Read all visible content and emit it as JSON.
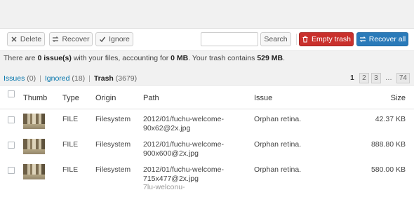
{
  "toolbar": {
    "delete_label": "Delete",
    "recover_label": "Recover",
    "ignore_label": "Ignore",
    "search_placeholder": "",
    "search_label": "Search",
    "empty_trash_label": "Empty trash",
    "recover_all_label": "Recover all"
  },
  "summary": {
    "before": "There are ",
    "issues": "0 issue(s)",
    "middle1": " with your files, accounting for ",
    "size": "0 MB",
    "middle2": ". Your trash contains ",
    "trash": "529 MB",
    "end": "."
  },
  "filters": [
    {
      "label": "Issues",
      "count": "(0)"
    },
    {
      "label": "Ignored",
      "count": "(18)"
    },
    {
      "label": "Trash",
      "count": "(3679)"
    }
  ],
  "pagination": [
    "1",
    "2",
    "3",
    "…",
    "74"
  ],
  "table": {
    "headers": [
      "Thumb",
      "Type",
      "Origin",
      "Path",
      "Issue",
      "Size"
    ],
    "rows": [
      {
        "type": "FILE",
        "origin": "Filesystem",
        "path1": "2012/01/fuchu-welcome-",
        "path2": "90x62@2x.jpg",
        "issue": "Orphan retina.",
        "size": "42.37 KB"
      },
      {
        "type": "FILE",
        "origin": "Filesystem",
        "path1": "2012/01/fuchu-welcome-",
        "path2": "900x600@2x.jpg",
        "issue": "Orphan retina.",
        "size": "888.80 KB"
      },
      {
        "type": "FILE",
        "origin": "Filesystem",
        "path1": "2012/01/fuchu-welcome-",
        "path2": "715x477@2x.jpg",
        "issue": "Orphan retina.",
        "size": "580.00 KB"
      }
    ],
    "partial_row": "7lu-welconu-"
  },
  "colors": {
    "empty_trash": "#c9302c",
    "recover_all": "#2a7ab9",
    "link": "#0073aa"
  }
}
